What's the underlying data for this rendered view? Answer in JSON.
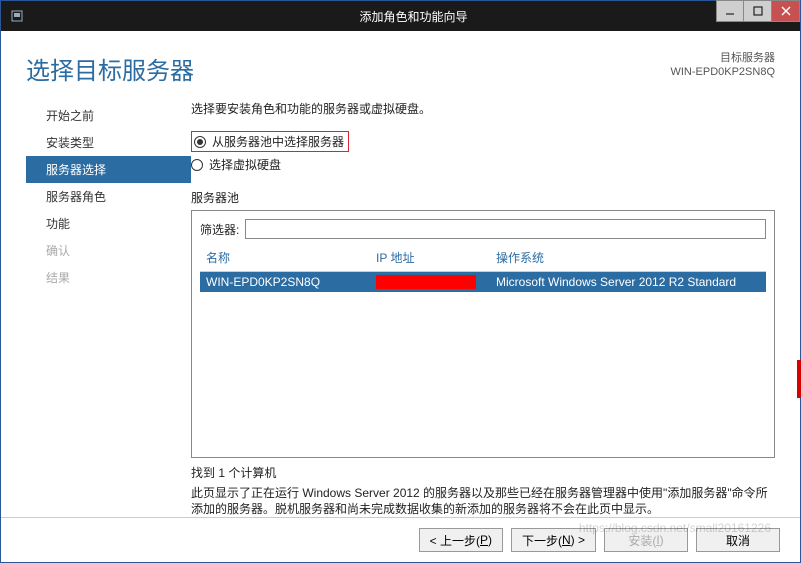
{
  "window": {
    "title": "添加角色和功能向导"
  },
  "header": {
    "page_title": "选择目标服务器",
    "target_label": "目标服务器",
    "target_value": "WIN-EPD0KP2SN8Q"
  },
  "sidebar": {
    "items": [
      {
        "label": "开始之前",
        "state": "normal"
      },
      {
        "label": "安装类型",
        "state": "normal"
      },
      {
        "label": "服务器选择",
        "state": "sel"
      },
      {
        "label": "服务器角色",
        "state": "normal"
      },
      {
        "label": "功能",
        "state": "normal"
      },
      {
        "label": "确认",
        "state": "dim"
      },
      {
        "label": "结果",
        "state": "dim"
      }
    ]
  },
  "content": {
    "instruction": "选择要安装角色和功能的服务器或虚拟硬盘。",
    "radio_pool": "从服务器池中选择服务器",
    "radio_vhd": "选择虚拟硬盘",
    "pool_label": "服务器池",
    "filter_label": "筛选器:",
    "filter_value": "",
    "cols": {
      "name": "名称",
      "ip": "IP 地址",
      "os": "操作系统"
    },
    "rows": [
      {
        "name": "WIN-EPD0KP2SN8Q",
        "ip": "",
        "os": "Microsoft Windows Server 2012 R2 Standard"
      }
    ],
    "found": "找到 1 个计算机",
    "description": "此页显示了正在运行 Windows Server 2012 的服务器以及那些已经在服务器管理器中使用\"添加服务器\"命令所添加的服务器。脱机服务器和尚未完成数据收集的新添加的服务器将不会在此页中显示。"
  },
  "buttons": {
    "prev": "< 上一步(",
    "prev_u": "P",
    "prev2": ")",
    "next": "下一步(",
    "next_u": "N",
    "next2": ") >",
    "install": "安装(",
    "install_u": "I",
    "install2": ")",
    "cancel": "取消"
  },
  "watermark": "https://blog.csdn.net/small20161226"
}
